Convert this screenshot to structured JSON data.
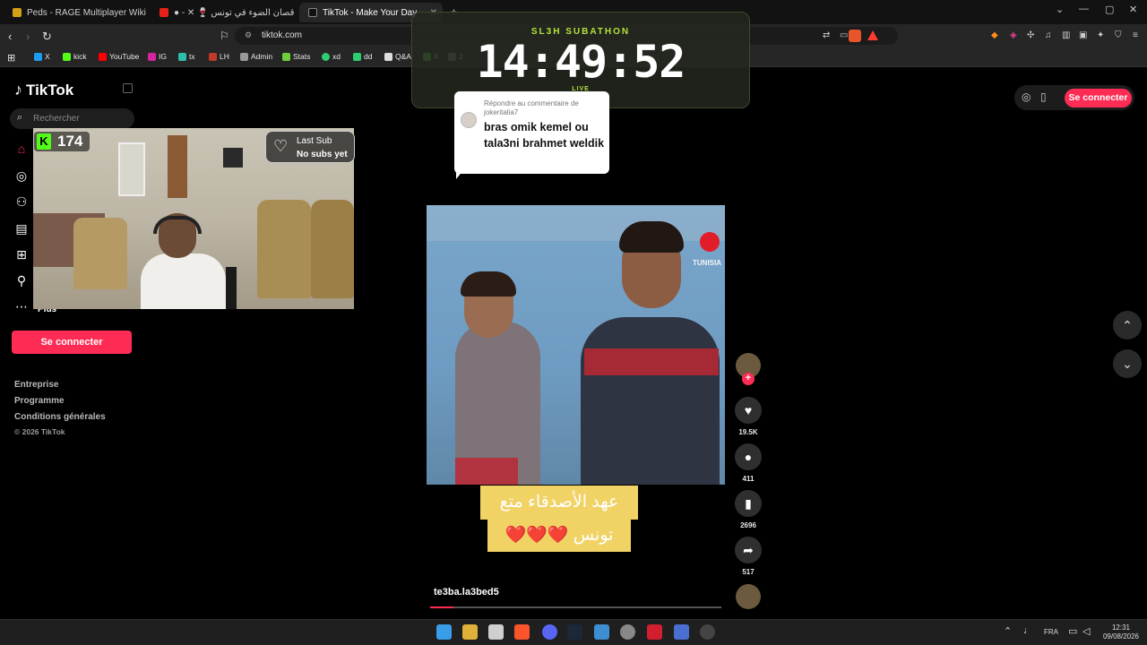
{
  "browser": {
    "tabs": [
      {
        "label": "Peds - RAGE Multiplayer Wiki",
        "color": "#d4a017"
      },
      {
        "label": "حلقة قصان الضوء في تونس 🍷 ✕ - ●",
        "color": "#e62117"
      },
      {
        "label": "TikTok - Make Your Day",
        "color": "#111111"
      }
    ],
    "url": "tiktok.com",
    "bookmarks": [
      {
        "label": "X",
        "color": "#1d9bf0"
      },
      {
        "label": "kick",
        "color": "#53fc18"
      },
      {
        "label": "YouTube",
        "color": "#ff0000"
      },
      {
        "label": "IG",
        "color": "#d6249f"
      },
      {
        "label": "tx",
        "color": "#2ebdac"
      },
      {
        "label": "LH",
        "color": "#c0392b"
      },
      {
        "label": "Admin",
        "color": "#999999"
      },
      {
        "label": "Stats",
        "color": "#6fcf3b"
      },
      {
        "label": "xd",
        "color": "#2ecc71"
      },
      {
        "label": "dd",
        "color": "#2ecc71"
      },
      {
        "label": "Q&A",
        "color": "#dddddd"
      },
      {
        "label": "K",
        "color": "#6fcf3b"
      },
      {
        "label": "2",
        "color": "#888888"
      }
    ]
  },
  "tiktok": {
    "logo": "TikTok",
    "search_placeholder": "Rechercher",
    "more_label": "Plus",
    "connect_label": "Se connecter",
    "footer_links": [
      "Entreprise",
      "Programme",
      "Conditions générales"
    ],
    "copyright": "© 2026 TikTok",
    "username": "te3ba.la3bed5",
    "likes": "19.5K",
    "comments": "411",
    "saves": "2696",
    "shares": "517",
    "caption_line1": "عهد الأصدقاء متع",
    "caption_line2": "تونس ❤️❤️❤️",
    "watermark": "TUNISIA",
    "progress": 0.08
  },
  "overlay": {
    "kick_count": "174",
    "last_sub_title": "Last Sub",
    "last_sub_value": "No subs yet",
    "timer_title": "SL3H SUBATHON",
    "timer_value": "14:49:52",
    "timer_status": "LIVE"
  },
  "comment": {
    "reply_text": "Répondre au commentaire de jokeritalia7",
    "text": "bras omik kemel ou tala3ni brahmet weldik"
  },
  "taskbar": {
    "language": "FRA",
    "time": "12:31",
    "date": "09/08/2026"
  }
}
